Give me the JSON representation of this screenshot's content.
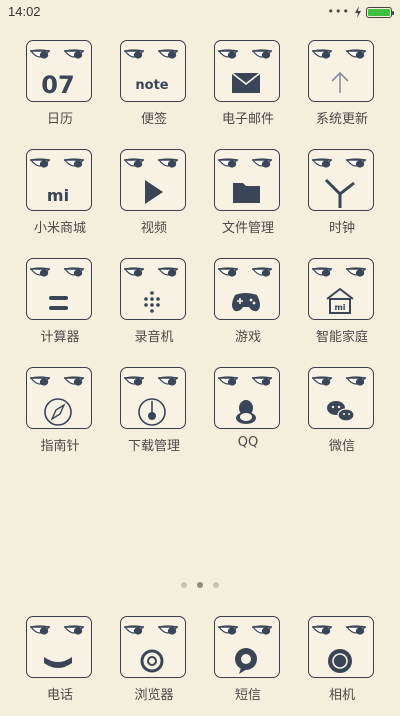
{
  "status_bar": {
    "time": "14:02",
    "signal": "•••",
    "battery_level": 1.0,
    "battery_color": "#3ec23e"
  },
  "apps": [
    {
      "label": "日历",
      "icon": "calendar-icon",
      "glyph": "07"
    },
    {
      "label": "便签",
      "icon": "notes-icon",
      "glyph": "note"
    },
    {
      "label": "电子邮件",
      "icon": "mail-icon"
    },
    {
      "label": "系统更新",
      "icon": "update-arrow-icon"
    },
    {
      "label": "小米商城",
      "icon": "mi-logo-icon",
      "glyph": "mi"
    },
    {
      "label": "视频",
      "icon": "play-icon"
    },
    {
      "label": "文件管理",
      "icon": "folder-icon"
    },
    {
      "label": "时钟",
      "icon": "clock-icon"
    },
    {
      "label": "计算器",
      "icon": "equals-icon"
    },
    {
      "label": "录音机",
      "icon": "recorder-dots-icon"
    },
    {
      "label": "游戏",
      "icon": "gamepad-icon"
    },
    {
      "label": "智能家庭",
      "icon": "smart-home-icon"
    },
    {
      "label": "指南针",
      "icon": "compass-icon"
    },
    {
      "label": "下载管理",
      "icon": "download-icon"
    },
    {
      "label": "QQ",
      "icon": "qq-penguin-icon"
    },
    {
      "label": "微信",
      "icon": "wechat-icon"
    }
  ],
  "pager": {
    "count": 3,
    "active": 1
  },
  "dock": [
    {
      "label": "电话",
      "icon": "phone-icon"
    },
    {
      "label": "浏览器",
      "icon": "browser-icon"
    },
    {
      "label": "短信",
      "icon": "message-icon"
    },
    {
      "label": "相机",
      "icon": "camera-icon"
    }
  ],
  "colors": {
    "background": "#f4eedd",
    "icon_ink": "#3a4657",
    "label": "#4a4a4a"
  }
}
